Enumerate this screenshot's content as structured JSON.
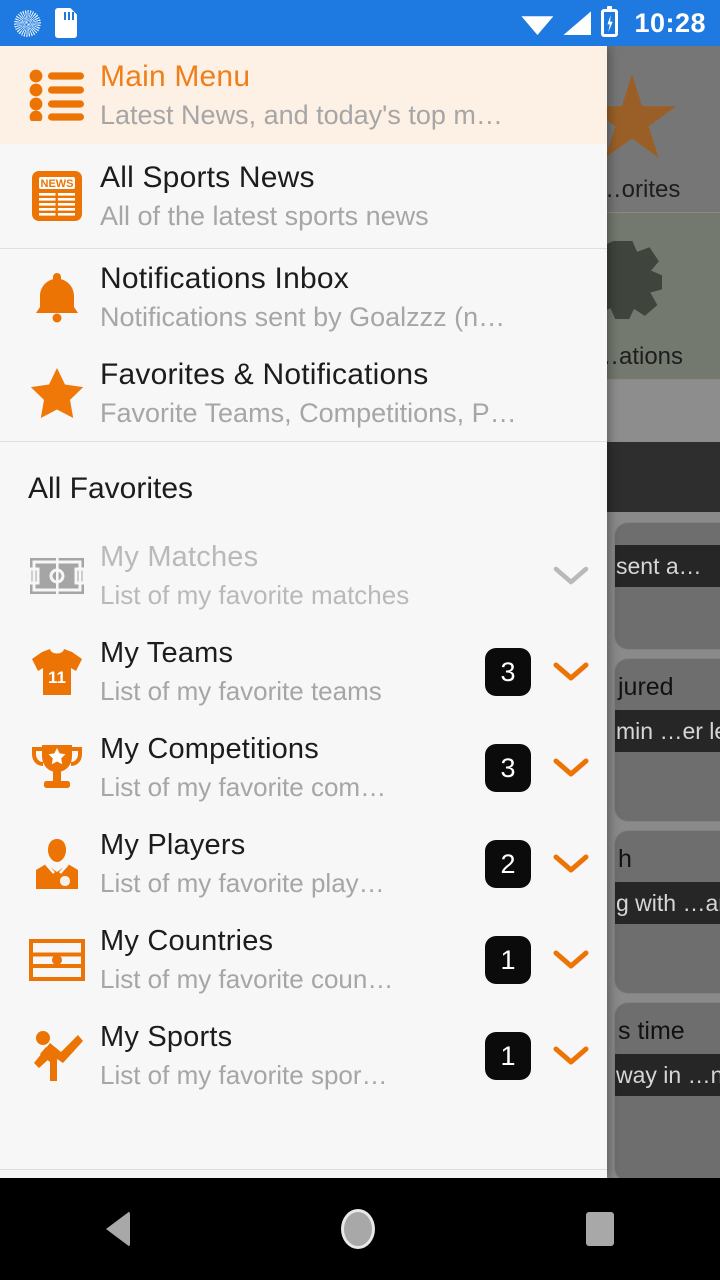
{
  "statusbar": {
    "time": "10:28",
    "icons": [
      "sync-icon",
      "sd-card-icon",
      "wifi-icon",
      "cell-signal-icon",
      "battery-charging-icon"
    ]
  },
  "drawer": {
    "header": {
      "icon": "bulleted-list-icon",
      "title": "Main Menu",
      "subtitle": "Latest News, and today's top m…",
      "accent_color": "#ef7f1a",
      "background_color": "#fdf0e4"
    },
    "items": [
      {
        "icon": "news-icon",
        "title": "All Sports News",
        "subtitle": "All of the latest sports news"
      },
      {
        "icon": "bell-icon",
        "title": "Notifications Inbox",
        "subtitle": "Notifications sent by Goalzzz (n…"
      },
      {
        "icon": "star-icon",
        "title": "Favorites & Notifications",
        "subtitle": "Favorite Teams, Competitions, P…"
      }
    ],
    "section_title": "All Favorites",
    "favorites": [
      {
        "icon": "pitch-icon",
        "title": "My Matches",
        "subtitle": "List of my favorite matches",
        "badge": "",
        "disabled": true,
        "chevron": "chevron-down-icon"
      },
      {
        "icon": "jersey-icon",
        "title": "My Teams",
        "subtitle": "List of my favorite teams",
        "badge": "3",
        "disabled": false,
        "chevron": "chevron-down-icon"
      },
      {
        "icon": "trophy-icon",
        "title": "My Competitions",
        "subtitle": "List of my favorite com…",
        "badge": "3",
        "disabled": false,
        "chevron": "chevron-down-icon"
      },
      {
        "icon": "player-icon",
        "title": "My Players",
        "subtitle": "List of my favorite play…",
        "badge": "2",
        "disabled": false,
        "chevron": "chevron-down-icon"
      },
      {
        "icon": "flag-icon",
        "title": "My Countries",
        "subtitle": "List of my favorite coun…",
        "badge": "1",
        "disabled": false,
        "chevron": "chevron-down-icon"
      },
      {
        "icon": "sports-icon",
        "title": "My Sports",
        "subtitle": "List of my favorite spor…",
        "badge": "1",
        "disabled": false,
        "chevron": "chevron-down-icon"
      }
    ]
  },
  "background": {
    "tiles": [
      {
        "icon": "star-icon",
        "label": "…orites"
      },
      {
        "icon": "gear-icon",
        "label": "…ations"
      }
    ],
    "cards": [
      {
        "title": "",
        "subtitle": "…sent a…"
      },
      {
        "title": "…jured",
        "subtitle": "…min …er leg i…"
      },
      {
        "title": "…h",
        "subtitle": "…g with …an on …"
      },
      {
        "title": "…s time",
        "subtitle": "…way in …n stag…"
      }
    ]
  },
  "navbar": {
    "back": "back-icon",
    "home": "home-icon",
    "recents": "recents-icon"
  }
}
